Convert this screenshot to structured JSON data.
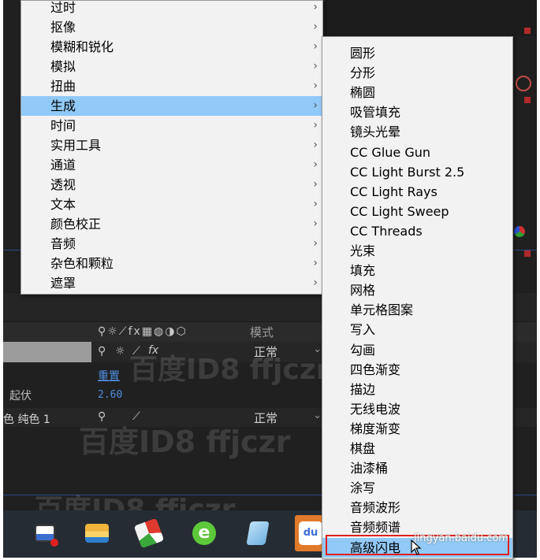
{
  "main_menu": {
    "items": [
      {
        "label": "过时",
        "highlighted": false
      },
      {
        "label": "抠像",
        "highlighted": false
      },
      {
        "label": "模糊和锐化",
        "highlighted": false
      },
      {
        "label": "模拟",
        "highlighted": false
      },
      {
        "label": "扭曲",
        "highlighted": false
      },
      {
        "label": "生成",
        "highlighted": true
      },
      {
        "label": "时间",
        "highlighted": false
      },
      {
        "label": "实用工具",
        "highlighted": false
      },
      {
        "label": "通道",
        "highlighted": false
      },
      {
        "label": "透视",
        "highlighted": false
      },
      {
        "label": "文本",
        "highlighted": false
      },
      {
        "label": "颜色校正",
        "highlighted": false
      },
      {
        "label": "音频",
        "highlighted": false
      },
      {
        "label": "杂色和颗粒",
        "highlighted": false
      },
      {
        "label": "遮罩",
        "highlighted": false
      }
    ],
    "arrow": "›"
  },
  "submenu": {
    "items": [
      {
        "label": "圆形"
      },
      {
        "label": "分形"
      },
      {
        "label": "椭圆"
      },
      {
        "label": "吸管填充"
      },
      {
        "label": "镜头光晕"
      },
      {
        "label": "CC Glue Gun"
      },
      {
        "label": "CC Light Burst 2.5"
      },
      {
        "label": "CC Light Rays"
      },
      {
        "label": "CC Light Sweep"
      },
      {
        "label": "CC Threads"
      },
      {
        "label": "光束"
      },
      {
        "label": "填充"
      },
      {
        "label": "网格"
      },
      {
        "label": "单元格图案"
      },
      {
        "label": "写入"
      },
      {
        "label": "勾画"
      },
      {
        "label": "四色渐变"
      },
      {
        "label": "描边"
      },
      {
        "label": "无线电波"
      },
      {
        "label": "梯度渐变"
      },
      {
        "label": "棋盘"
      },
      {
        "label": "油漆桶"
      },
      {
        "label": "涂写"
      },
      {
        "label": "音频波形"
      },
      {
        "label": "音频频谱"
      },
      {
        "label": "高级闪电"
      }
    ],
    "highlighted_index": 25
  },
  "timeline": {
    "mode_header": "模式",
    "switch_icons": "⚲☼⟋fx▦◍◑⬡",
    "layer_1": {
      "mode": "正常"
    },
    "reset_link": "重置",
    "property_label": "起伏",
    "property_value": "2.60",
    "layer_2": {
      "name": "色 纯色 1",
      "mode": "正常"
    }
  },
  "watermarks": {
    "baidu_id": "百度ID8 ffjczr",
    "site": "jingyan.baidu.com"
  },
  "taskbar": {
    "apps": [
      {
        "icon": "remote-desktop-icon",
        "color": "#3a6fd0"
      },
      {
        "icon": "file-explorer-icon",
        "color": "#f0b43c"
      },
      {
        "icon": "color-picker-app-icon",
        "color": "#e0392f"
      },
      {
        "icon": "browser-e-icon",
        "color": "#5cc83a"
      },
      {
        "icon": "notepad-icon",
        "color": "#6fb0e0"
      },
      {
        "icon": "baidu-app-icon",
        "color": "#3b6fd8",
        "active": true
      }
    ]
  },
  "colors": {
    "menu_bg": "#f2f2f2",
    "menu_highlight": "#91c9f7",
    "annotation_box": "#e01f1f",
    "link_blue": "#4f8ee0"
  }
}
